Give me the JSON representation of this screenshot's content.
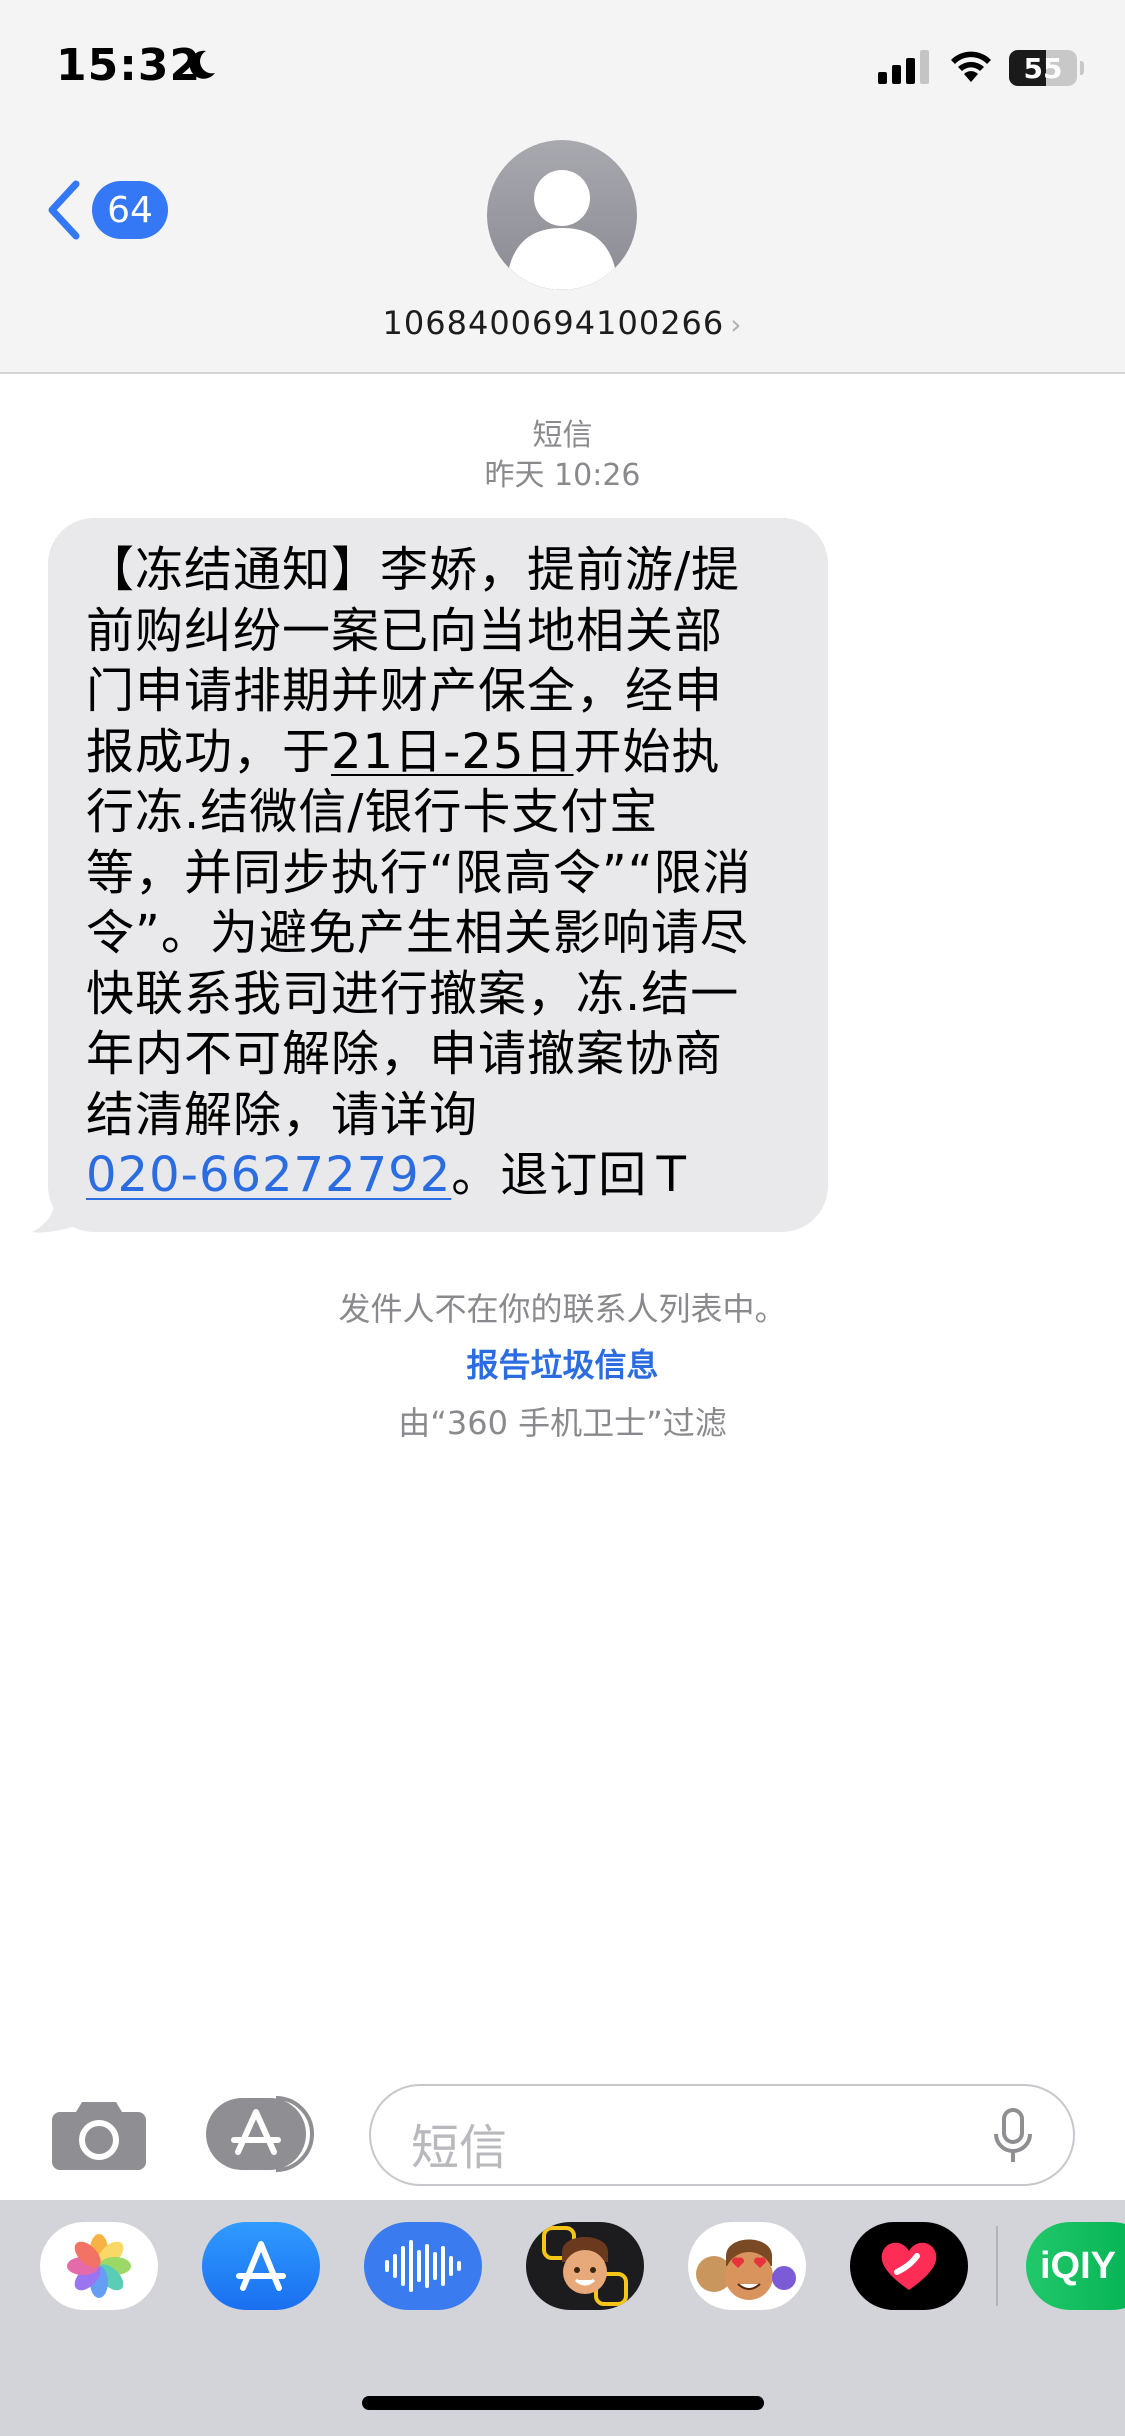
{
  "status_bar": {
    "time": "15:32",
    "battery": "55",
    "battery_level": 0.55
  },
  "header": {
    "back_count": "64",
    "contact": "1068400694100266"
  },
  "conversation": {
    "service": "短信",
    "timestamp": "昨天 10:26",
    "message": {
      "l1": "【冻结通知】李娇，提前游/提",
      "l2": "前购纠纷一案已向当地相关部",
      "l3": "门申请排期并财产保全，经申",
      "l4a": "报成功，于",
      "l4b": "21日-25日",
      "l4c": "开始执",
      "l5": "行冻.结微信/银行卡支付宝",
      "l6": "等，并同步执行“限高令”“限消",
      "l7": "令”。为避免产生相关影响请尽",
      "l8": "快联系我司进行撤案，冻.结一",
      "l9": "年内不可解除，申请撤案协商",
      "l10": "结清解除，请详询",
      "phone": "020-66272792",
      "tail": "。退订回Ｔ"
    },
    "not_in_contacts": "发件人不在你的联系人列表中。",
    "report_junk": "报告垃圾信息",
    "filtered_by": "由“360 手机卫士”过滤"
  },
  "input": {
    "placeholder": "短信"
  },
  "app_drawer": {
    "apps": [
      {
        "name": "photos-app-icon"
      },
      {
        "name": "app-store-icon"
      },
      {
        "name": "audio-message-icon"
      },
      {
        "name": "memoji-icon"
      },
      {
        "name": "memoji-stickers-icon"
      },
      {
        "name": "digital-touch-icon"
      },
      {
        "name": "iqiyi-app-icon",
        "label": "iQIY"
      }
    ],
    "accent": "#3478f6"
  }
}
